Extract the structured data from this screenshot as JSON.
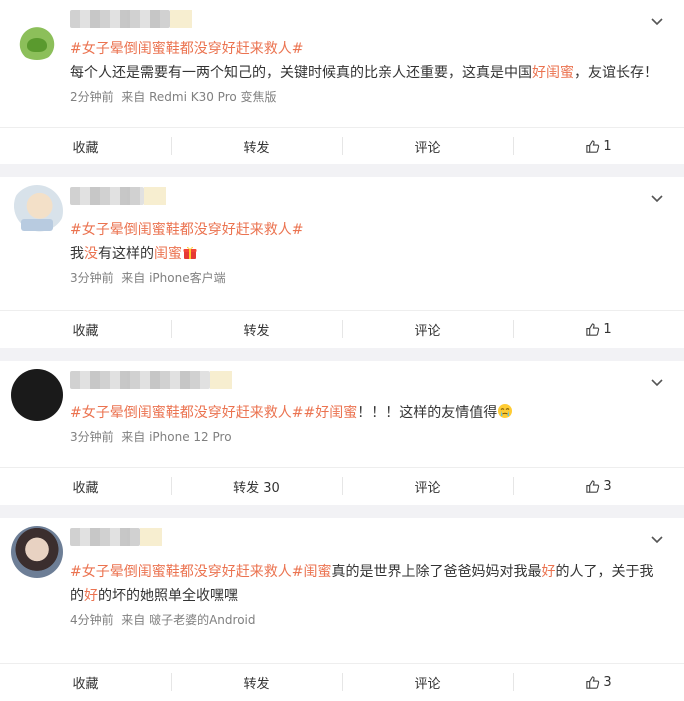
{
  "posts": [
    {
      "hashtag": "#女子晕倒闺蜜鞋都没穿好赶来救人#",
      "text_before": "每个人还是需要有一两个知己的，关键时候真的比亲人还重要，这真是中国",
      "text_link": "好闺蜜",
      "text_after": "，友谊长存！",
      "time": "2分钟前",
      "source": "来自 Redmi K30 Pro 变焦版",
      "actions": {
        "fav": "收藏",
        "repost": "转发",
        "comment": "评论",
        "likes": "1"
      }
    },
    {
      "hashtag": "#女子晕倒闺蜜鞋都没穿好赶来救人#",
      "text_a": "我",
      "text_b": "没",
      "text_c": "有这样的",
      "text_link": "闺蜜",
      "time": "3分钟前",
      "source": "来自 iPhone客户端",
      "actions": {
        "fav": "收藏",
        "repost": "转发",
        "comment": "评论",
        "likes": "1"
      }
    },
    {
      "hashtag": "#女子晕倒闺蜜鞋都没穿好赶来救人#",
      "hashtag2": "#好闺蜜",
      "text_after": "！！！这样的友情值得",
      "time": "3分钟前",
      "source": "来自 iPhone 12 Pro",
      "actions": {
        "fav": "收藏",
        "repost": "转发 30",
        "comment": "评论",
        "likes": "3"
      }
    },
    {
      "hashtag": "#女子晕倒闺蜜鞋都没穿好赶来救人#",
      "hashtag2": "闺蜜",
      "text_mid": "真的是世界上除了爸爸妈妈对我最",
      "text_link": "好",
      "text_after": "的人了，关于我",
      "line2_a": "的",
      "line2_link": "好",
      "line2_b": "的坏的她照单全收嘿嘿",
      "time": "4分钟前",
      "source": "来自 啵子老婆的Android",
      "actions": {
        "fav": "收藏",
        "repost": "转发",
        "comment": "评论",
        "likes": "3"
      }
    }
  ],
  "icons": {
    "expand": "chevron-down-icon",
    "like": "thumbs-up-icon",
    "gift": "gift-emoji",
    "cry": "crying-emoji"
  },
  "colors": {
    "link": "#eb7350",
    "meta": "#808080",
    "background": "#f2f2f5"
  }
}
